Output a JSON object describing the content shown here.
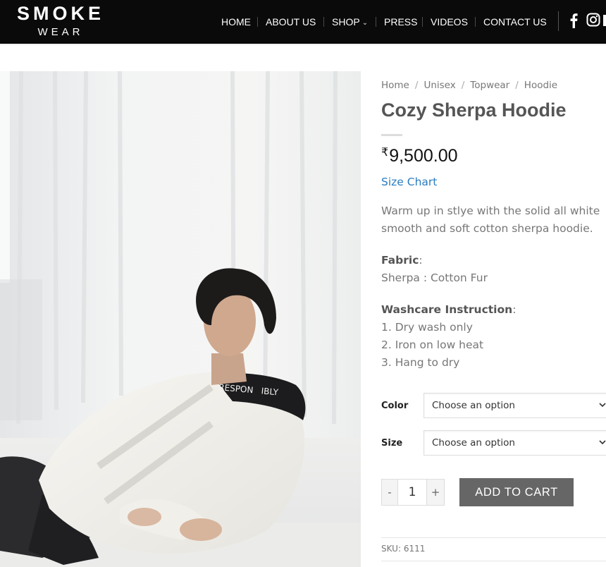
{
  "header": {
    "logo_top": "SMOKE",
    "logo_bottom": "WEAR",
    "nav": [
      {
        "label": "HOME"
      },
      {
        "label": "ABOUT US"
      },
      {
        "label": "SHOP"
      },
      {
        "label": "PRESS"
      },
      {
        "label": "VIDEOS"
      },
      {
        "label": "CONTACT US"
      }
    ],
    "social_icons": [
      "facebook-icon",
      "instagram-icon"
    ]
  },
  "product": {
    "breadcrumb": [
      "Home",
      "Unisex",
      "Topwear",
      "Hoodie"
    ],
    "title": "Cozy Sherpa Hoodie",
    "currency_symbol": "₹",
    "price": "9,500.00",
    "size_chart": "Size Chart",
    "description": "Warm up in stlye with the solid all white smooth and soft cotton sherpa hoodie.",
    "fabric_label": "Fabric",
    "fabric_value": "Sherpa : Cotton Fur",
    "washcare_label": "Washcare Instruction",
    "washcare": [
      "1. Dry wash only",
      "2. Iron on low heat",
      "3. Hang to dry"
    ],
    "variations": {
      "color_label": "Color",
      "color_value": "Choose an option",
      "size_label": "Size",
      "size_value": "Choose an option"
    },
    "quantity": {
      "minus": "-",
      "value": "1",
      "plus": "+"
    },
    "add_to_cart": "ADD TO CART",
    "sku_label": "SKU:",
    "sku_value": "6111"
  },
  "colors": {
    "header_bg": "#0a0a0a",
    "link_blue": "#2a7cc0",
    "button_gray": "#666666"
  }
}
